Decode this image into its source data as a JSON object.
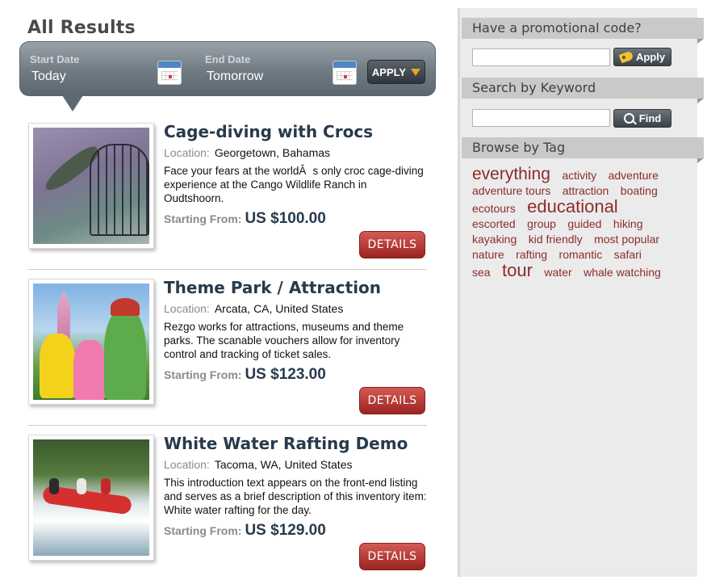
{
  "page_title": "All Results",
  "date_bar": {
    "start_label": "Start Date",
    "start_value": "Today",
    "end_label": "End Date",
    "end_value": "Tomorrow",
    "apply_label": "APPLY"
  },
  "results": [
    {
      "title": "Cage-diving with Crocs",
      "location_label": "Location:",
      "location": "Georgetown, Bahamas",
      "description": "Face your fears at the worldÂs only croc cage-diving experience at the Cango Wildlife Ranch in Oudtshoorn.",
      "price_label": "Starting From:",
      "price": "US $100.00",
      "details_label": "DETAILS"
    },
    {
      "title": "Theme Park / Attraction",
      "location_label": "Location:",
      "location": "Arcata, CA, United States",
      "description": "Rezgo works for attractions, museums and theme parks. The scanable vouchers allow for inventory control and tracking of ticket sales.",
      "price_label": "Starting From:",
      "price": "US $123.00",
      "details_label": "DETAILS"
    },
    {
      "title": "White Water Rafting Demo",
      "location_label": "Location:",
      "location": "Tacoma, WA, United States",
      "description": "This introduction text appears on the front-end listing and serves as a brief description of this inventory item: White water rafting for the day.",
      "price_label": "Starting From:",
      "price": "US $129.00",
      "details_label": "DETAILS"
    }
  ],
  "sidebar": {
    "promo_heading": "Have a promotional code?",
    "promo_value": "",
    "promo_button": "Apply",
    "keyword_heading": "Search by Keyword",
    "keyword_value": "",
    "keyword_button": "Find",
    "tags_heading": "Browse by Tag",
    "tags": [
      {
        "label": "everything",
        "size": "lg"
      },
      {
        "label": "activity",
        "size": "sm"
      },
      {
        "label": "adventure",
        "size": "sm"
      },
      {
        "label": "adventure tours",
        "size": "sm"
      },
      {
        "label": "attraction",
        "size": "sm"
      },
      {
        "label": "boating",
        "size": "sm"
      },
      {
        "label": "ecotours",
        "size": "sm"
      },
      {
        "label": "educational",
        "size": "xl"
      },
      {
        "label": "escorted",
        "size": "sm"
      },
      {
        "label": "group",
        "size": "sm"
      },
      {
        "label": "guided",
        "size": "sm"
      },
      {
        "label": "hiking",
        "size": "sm"
      },
      {
        "label": "kayaking",
        "size": "sm"
      },
      {
        "label": "kid friendly",
        "size": "sm"
      },
      {
        "label": "most popular",
        "size": "sm"
      },
      {
        "label": "nature",
        "size": "sm"
      },
      {
        "label": "rafting",
        "size": "sm"
      },
      {
        "label": "romantic",
        "size": "sm"
      },
      {
        "label": "safari",
        "size": "sm"
      },
      {
        "label": "sea",
        "size": "sm"
      },
      {
        "label": "tour",
        "size": "xl"
      },
      {
        "label": "water",
        "size": "sm"
      },
      {
        "label": "whale watching",
        "size": "sm"
      }
    ]
  },
  "colors": {
    "title_text": "#283a4c",
    "tag_text": "#8d2b2b",
    "details_button": "#b33b36",
    "sidebar_bg": "#ebebeb",
    "accent_caret": "#f0a020"
  },
  "icons": {
    "calendar": "calendar-icon",
    "apply_caret": "caret-down-icon",
    "promo_apply": "price-tag-icon",
    "find": "search-icon"
  }
}
